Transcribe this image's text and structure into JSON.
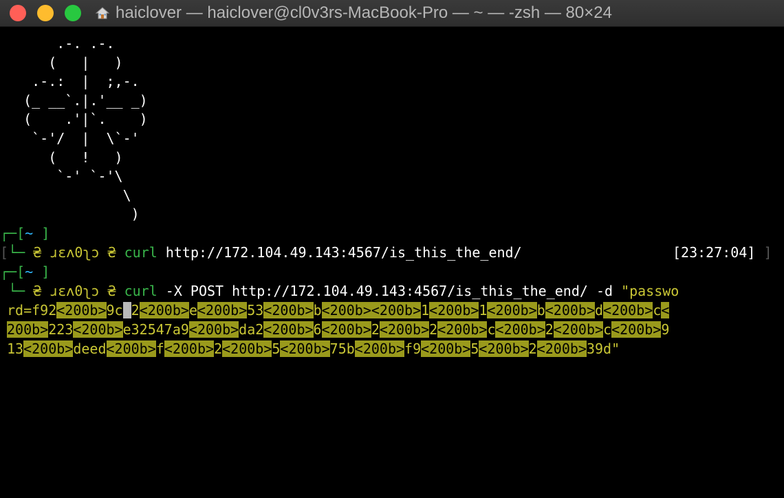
{
  "window": {
    "title": "haiclover — haiclover@cl0v3rs-MacBook-Pro — ~ — -zsh — 80×24"
  },
  "art": [
    "      .-. .-.",
    "     (   |   )",
    "   .-.:  |  ;,-.",
    "  (_ __`.|.'__ _)",
    "  (    .'|`.    )",
    "   `-'/  |  \\`-'",
    "     (   !   )",
    "      `-' `-'\\",
    "              \\",
    "               )"
  ],
  "prompt1": {
    "top": "┌─[",
    "dir": "~",
    "close": " ]",
    "corner": "└─",
    "user": "ɹɛʌ0ʅɔ",
    "cmd": "curl",
    "args": " http://172.104.49.143:4567/is_this_the_end/",
    "time": "[23:27:04]"
  },
  "prompt2": {
    "top": "┌─[",
    "dir": "~",
    "close": " ]",
    "corner": "└─",
    "user": "ɹɛʌ0ʅɔ",
    "cmd": "curl",
    "args": " -X POST http://172.104.49.143:4567/is_this_the_end/ -d ",
    "str_start": "\"passwo"
  },
  "wrap": {
    "line1": [
      {
        "t": "rd=f92",
        "h": false
      },
      {
        "t": "<200b>",
        "h": true
      },
      {
        "t": "9c",
        "h": false
      },
      {
        "t": " ",
        "h": false,
        "cur": true
      },
      {
        "t": "2",
        "h": false
      },
      {
        "t": "<200b>",
        "h": true
      },
      {
        "t": "e",
        "h": false
      },
      {
        "t": "<200b>",
        "h": true
      },
      {
        "t": "53",
        "h": false
      },
      {
        "t": "<200b>",
        "h": true
      },
      {
        "t": "b",
        "h": false
      },
      {
        "t": "<200b><200b>",
        "h": true
      },
      {
        "t": "1",
        "h": false
      },
      {
        "t": "<200b>",
        "h": true
      },
      {
        "t": "1",
        "h": false
      },
      {
        "t": "<200b>",
        "h": true
      },
      {
        "t": "b",
        "h": false
      },
      {
        "t": "<200b>",
        "h": true
      },
      {
        "t": "d",
        "h": false
      },
      {
        "t": "<200b>",
        "h": true
      },
      {
        "t": "c",
        "h": false
      },
      {
        "t": "<",
        "h": true
      }
    ],
    "line2": [
      {
        "t": "200b>",
        "h": true
      },
      {
        "t": "223",
        "h": false
      },
      {
        "t": "<200b>",
        "h": true
      },
      {
        "t": "e32547a9",
        "h": false
      },
      {
        "t": "<200b>",
        "h": true
      },
      {
        "t": "da2",
        "h": false
      },
      {
        "t": "<200b>",
        "h": true
      },
      {
        "t": "6",
        "h": false
      },
      {
        "t": "<200b>",
        "h": true
      },
      {
        "t": "2",
        "h": false
      },
      {
        "t": "<200b>",
        "h": true
      },
      {
        "t": "2",
        "h": false
      },
      {
        "t": "<200b>",
        "h": true
      },
      {
        "t": "c",
        "h": false
      },
      {
        "t": "<200b>",
        "h": true
      },
      {
        "t": "2",
        "h": false
      },
      {
        "t": "<200b>",
        "h": true
      },
      {
        "t": "c",
        "h": false
      },
      {
        "t": "<200b>",
        "h": true
      },
      {
        "t": "9",
        "h": false
      }
    ],
    "line3": [
      {
        "t": "13",
        "h": false
      },
      {
        "t": "<200b>",
        "h": true
      },
      {
        "t": "deed",
        "h": false
      },
      {
        "t": "<200b>",
        "h": true
      },
      {
        "t": "f",
        "h": false
      },
      {
        "t": "<200b>",
        "h": true
      },
      {
        "t": "2",
        "h": false
      },
      {
        "t": "<200b>",
        "h": true
      },
      {
        "t": "5",
        "h": false
      },
      {
        "t": "<200b>",
        "h": true
      },
      {
        "t": "75b",
        "h": false
      },
      {
        "t": "<200b>",
        "h": true
      },
      {
        "t": "f9",
        "h": false
      },
      {
        "t": "<200b>",
        "h": true
      },
      {
        "t": "5",
        "h": false
      },
      {
        "t": "<200b>",
        "h": true
      },
      {
        "t": "2",
        "h": false
      },
      {
        "t": "<200b>",
        "h": true
      },
      {
        "t": "39d",
        "h": false
      },
      {
        "t": "\"",
        "h": false,
        "plain": true
      }
    ]
  },
  "colors": {
    "prompt_green": "#39b54a",
    "user_yellow": "#c9c635",
    "string_yellow": "#c9c635",
    "highlight": "#9a9a1c",
    "dir_blue": "#2fb9ff"
  }
}
